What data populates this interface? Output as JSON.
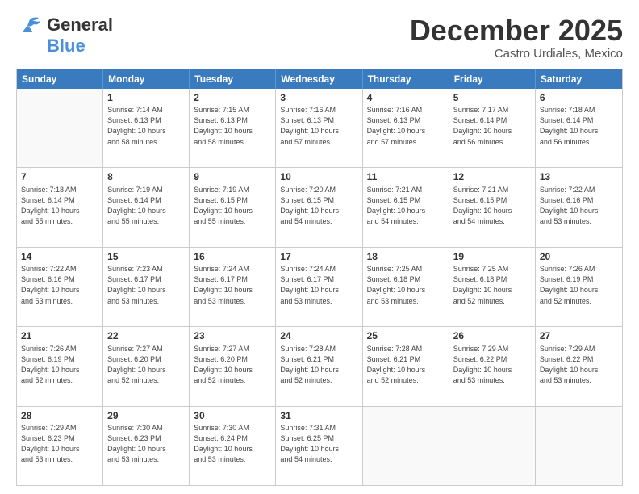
{
  "logo": {
    "line1": "General",
    "line2": "Blue"
  },
  "title": "December 2025",
  "location": "Castro Urdiales, Mexico",
  "weekdays": [
    "Sunday",
    "Monday",
    "Tuesday",
    "Wednesday",
    "Thursday",
    "Friday",
    "Saturday"
  ],
  "weeks": [
    [
      {
        "day": "",
        "info": ""
      },
      {
        "day": "1",
        "info": "Sunrise: 7:14 AM\nSunset: 6:13 PM\nDaylight: 10 hours\nand 58 minutes."
      },
      {
        "day": "2",
        "info": "Sunrise: 7:15 AM\nSunset: 6:13 PM\nDaylight: 10 hours\nand 58 minutes."
      },
      {
        "day": "3",
        "info": "Sunrise: 7:16 AM\nSunset: 6:13 PM\nDaylight: 10 hours\nand 57 minutes."
      },
      {
        "day": "4",
        "info": "Sunrise: 7:16 AM\nSunset: 6:13 PM\nDaylight: 10 hours\nand 57 minutes."
      },
      {
        "day": "5",
        "info": "Sunrise: 7:17 AM\nSunset: 6:14 PM\nDaylight: 10 hours\nand 56 minutes."
      },
      {
        "day": "6",
        "info": "Sunrise: 7:18 AM\nSunset: 6:14 PM\nDaylight: 10 hours\nand 56 minutes."
      }
    ],
    [
      {
        "day": "7",
        "info": "Sunrise: 7:18 AM\nSunset: 6:14 PM\nDaylight: 10 hours\nand 55 minutes."
      },
      {
        "day": "8",
        "info": "Sunrise: 7:19 AM\nSunset: 6:14 PM\nDaylight: 10 hours\nand 55 minutes."
      },
      {
        "day": "9",
        "info": "Sunrise: 7:19 AM\nSunset: 6:15 PM\nDaylight: 10 hours\nand 55 minutes."
      },
      {
        "day": "10",
        "info": "Sunrise: 7:20 AM\nSunset: 6:15 PM\nDaylight: 10 hours\nand 54 minutes."
      },
      {
        "day": "11",
        "info": "Sunrise: 7:21 AM\nSunset: 6:15 PM\nDaylight: 10 hours\nand 54 minutes."
      },
      {
        "day": "12",
        "info": "Sunrise: 7:21 AM\nSunset: 6:15 PM\nDaylight: 10 hours\nand 54 minutes."
      },
      {
        "day": "13",
        "info": "Sunrise: 7:22 AM\nSunset: 6:16 PM\nDaylight: 10 hours\nand 53 minutes."
      }
    ],
    [
      {
        "day": "14",
        "info": "Sunrise: 7:22 AM\nSunset: 6:16 PM\nDaylight: 10 hours\nand 53 minutes."
      },
      {
        "day": "15",
        "info": "Sunrise: 7:23 AM\nSunset: 6:17 PM\nDaylight: 10 hours\nand 53 minutes."
      },
      {
        "day": "16",
        "info": "Sunrise: 7:24 AM\nSunset: 6:17 PM\nDaylight: 10 hours\nand 53 minutes."
      },
      {
        "day": "17",
        "info": "Sunrise: 7:24 AM\nSunset: 6:17 PM\nDaylight: 10 hours\nand 53 minutes."
      },
      {
        "day": "18",
        "info": "Sunrise: 7:25 AM\nSunset: 6:18 PM\nDaylight: 10 hours\nand 53 minutes."
      },
      {
        "day": "19",
        "info": "Sunrise: 7:25 AM\nSunset: 6:18 PM\nDaylight: 10 hours\nand 52 minutes."
      },
      {
        "day": "20",
        "info": "Sunrise: 7:26 AM\nSunset: 6:19 PM\nDaylight: 10 hours\nand 52 minutes."
      }
    ],
    [
      {
        "day": "21",
        "info": "Sunrise: 7:26 AM\nSunset: 6:19 PM\nDaylight: 10 hours\nand 52 minutes."
      },
      {
        "day": "22",
        "info": "Sunrise: 7:27 AM\nSunset: 6:20 PM\nDaylight: 10 hours\nand 52 minutes."
      },
      {
        "day": "23",
        "info": "Sunrise: 7:27 AM\nSunset: 6:20 PM\nDaylight: 10 hours\nand 52 minutes."
      },
      {
        "day": "24",
        "info": "Sunrise: 7:28 AM\nSunset: 6:21 PM\nDaylight: 10 hours\nand 52 minutes."
      },
      {
        "day": "25",
        "info": "Sunrise: 7:28 AM\nSunset: 6:21 PM\nDaylight: 10 hours\nand 52 minutes."
      },
      {
        "day": "26",
        "info": "Sunrise: 7:29 AM\nSunset: 6:22 PM\nDaylight: 10 hours\nand 53 minutes."
      },
      {
        "day": "27",
        "info": "Sunrise: 7:29 AM\nSunset: 6:22 PM\nDaylight: 10 hours\nand 53 minutes."
      }
    ],
    [
      {
        "day": "28",
        "info": "Sunrise: 7:29 AM\nSunset: 6:23 PM\nDaylight: 10 hours\nand 53 minutes."
      },
      {
        "day": "29",
        "info": "Sunrise: 7:30 AM\nSunset: 6:23 PM\nDaylight: 10 hours\nand 53 minutes."
      },
      {
        "day": "30",
        "info": "Sunrise: 7:30 AM\nSunset: 6:24 PM\nDaylight: 10 hours\nand 53 minutes."
      },
      {
        "day": "31",
        "info": "Sunrise: 7:31 AM\nSunset: 6:25 PM\nDaylight: 10 hours\nand 54 minutes."
      },
      {
        "day": "",
        "info": ""
      },
      {
        "day": "",
        "info": ""
      },
      {
        "day": "",
        "info": ""
      }
    ]
  ]
}
